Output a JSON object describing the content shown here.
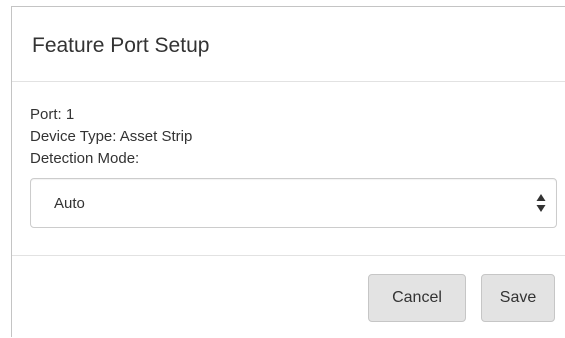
{
  "dialog": {
    "title": "Feature Port Setup",
    "port_line": "Port: 1",
    "device_type_line": "Device Type: Asset Strip",
    "detection_mode_label": "Detection Mode:",
    "detection_mode": {
      "selected": "Auto"
    },
    "buttons": {
      "cancel_label": "Cancel",
      "save_label": "Save"
    }
  },
  "icons": {
    "select_arrows": "up-down-arrows-icon"
  },
  "colors": {
    "button_bg": "#e3e3e3",
    "border": "#cccccc",
    "text": "#333333"
  }
}
